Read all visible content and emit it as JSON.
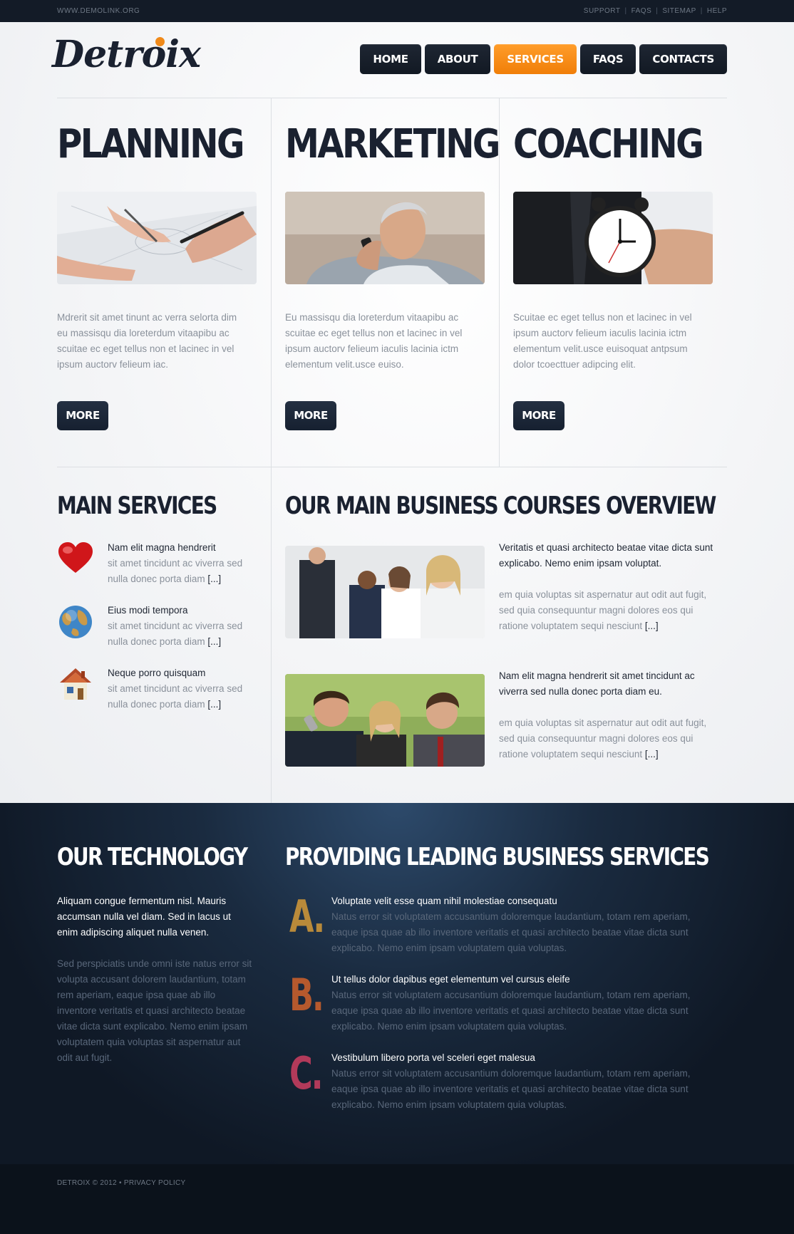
{
  "topbar": {
    "site": "WWW.DEMOLINK.ORG",
    "links": [
      "SUPPORT",
      "FAQS",
      "SITEMAP",
      "HELP"
    ]
  },
  "logo": {
    "text": "Detroix",
    "accent_color": "#f08a1a"
  },
  "nav": {
    "items": [
      "HOME",
      "ABOUT",
      "SERVICES",
      "FAQS",
      "CONTACTS"
    ],
    "active": "SERVICES"
  },
  "columns": [
    {
      "title": "PLANNING",
      "text": "Mdrerit sit amet tinunt ac verra selorta dim eu massisqu dia loreterdum vitaapibu ac scuitae ec eget tellus non et lacinec in vel ipsum auctorv felieum iac.",
      "button": "MORE"
    },
    {
      "title": "MARKETING",
      "text": "Eu massisqu dia loreterdum vitaapibu ac scuitae ec eget tellus non et lacinec in vel ipsum auctorv felieum iaculis lacinia ictm elementum velit.usce euiso.",
      "button": "MORE"
    },
    {
      "title": "COACHING",
      "text": "Scuitae ec eget tellus non et lacinec in vel ipsum auctorv felieum iaculis lacinia ictm elementum velit.usce euisoquat antpsum dolor tcoecttuer adipcing elit.",
      "button": "MORE"
    }
  ],
  "main_services": {
    "title": "MAIN SERVICES",
    "items": [
      {
        "icon": "heart-icon",
        "title": "Nam elit magna hendrerit",
        "text": "sit amet tincidunt ac viverra sed nulla donec porta diam",
        "more": "[...]"
      },
      {
        "icon": "globe-icon",
        "title": "Eius modi tempora",
        "text": "sit amet tincidunt ac viverra sed nulla donec porta diam",
        "more": "[...]"
      },
      {
        "icon": "house-icon",
        "title": "Neque porro quisquam",
        "text": "sit amet tincidunt ac viverra sed nulla donec porta diam",
        "more": "[...]"
      }
    ]
  },
  "courses": {
    "title": "OUR MAIN BUSINESS COURSES OVERVIEW",
    "items": [
      {
        "title": "Veritatis et quasi architecto beatae vitae dicta sunt explicabo. Nemo enim ipsam voluptat.",
        "text": "em quia voluptas sit aspernatur aut odit aut fugit, sed quia consequuntur magni dolores eos qui ratione voluptatem sequi nesciunt",
        "more": "[...]"
      },
      {
        "title": "Nam elit magna hendrerit sit amet tincidunt ac viverra sed nulla donec porta diam eu.",
        "text": "em quia voluptas sit aspernatur aut odit aut fugit, sed quia consequuntur magni dolores eos qui ratione voluptatem sequi nesciunt",
        "more": "[...]"
      }
    ]
  },
  "technology": {
    "title": "OUR TECHNOLOGY",
    "lead": "Aliquam congue fermentum nisl. Mauris accumsan nulla vel diam. Sed in lacus ut enim adipiscing aliquet nulla venen.",
    "text": "Sed perspiciatis unde omni iste natus error sit volupta accusant dolorem laudantium, totam rem aperiam, eaque ipsa quae ab illo inventore veritatis et quasi architecto beatae vitae dicta sunt explicabo. Nemo enim ipsam voluptatem quia voluptas sit aspernatur aut odit aut fugit."
  },
  "providing": {
    "title": "PROVIDING LEADING BUSINESS SERVICES",
    "items": [
      {
        "letter": "A.",
        "color": "#b98a3a",
        "title": "Voluptate velit esse quam nihil molestiae consequatu",
        "text": "Natus error sit voluptatem accusantium doloremque laudantium, totam rem aperiam, eaque ipsa quae ab illo inventore veritatis et quasi architecto beatae vitae dicta sunt explicabo. Nemo enim ipsam voluptatem quia voluptas."
      },
      {
        "letter": "B.",
        "color": "#b5592d",
        "title": "Ut tellus dolor dapibus eget elementum vel cursus eleife",
        "text": "Natus error sit voluptatem accusantium doloremque laudantium, totam rem aperiam, eaque ipsa quae ab illo inventore veritatis et quasi architecto beatae vitae dicta sunt explicabo. Nemo enim ipsam voluptatem quia voluptas."
      },
      {
        "letter": "C.",
        "color": "#b23a5a",
        "title": "Vestibulum libero porta vel sceleri eget malesua",
        "text": "Natus error sit voluptatem accusantium doloremque laudantium, totam rem aperiam, eaque ipsa quae ab illo inventore veritatis et quasi architecto beatae vitae dicta sunt explicabo. Nemo enim ipsam voluptatem quia voluptas."
      }
    ]
  },
  "footer": {
    "brand": "DETROIX",
    "copyright": "© 2012",
    "bullet": "•",
    "policy": "PRIVACY POLICY"
  }
}
